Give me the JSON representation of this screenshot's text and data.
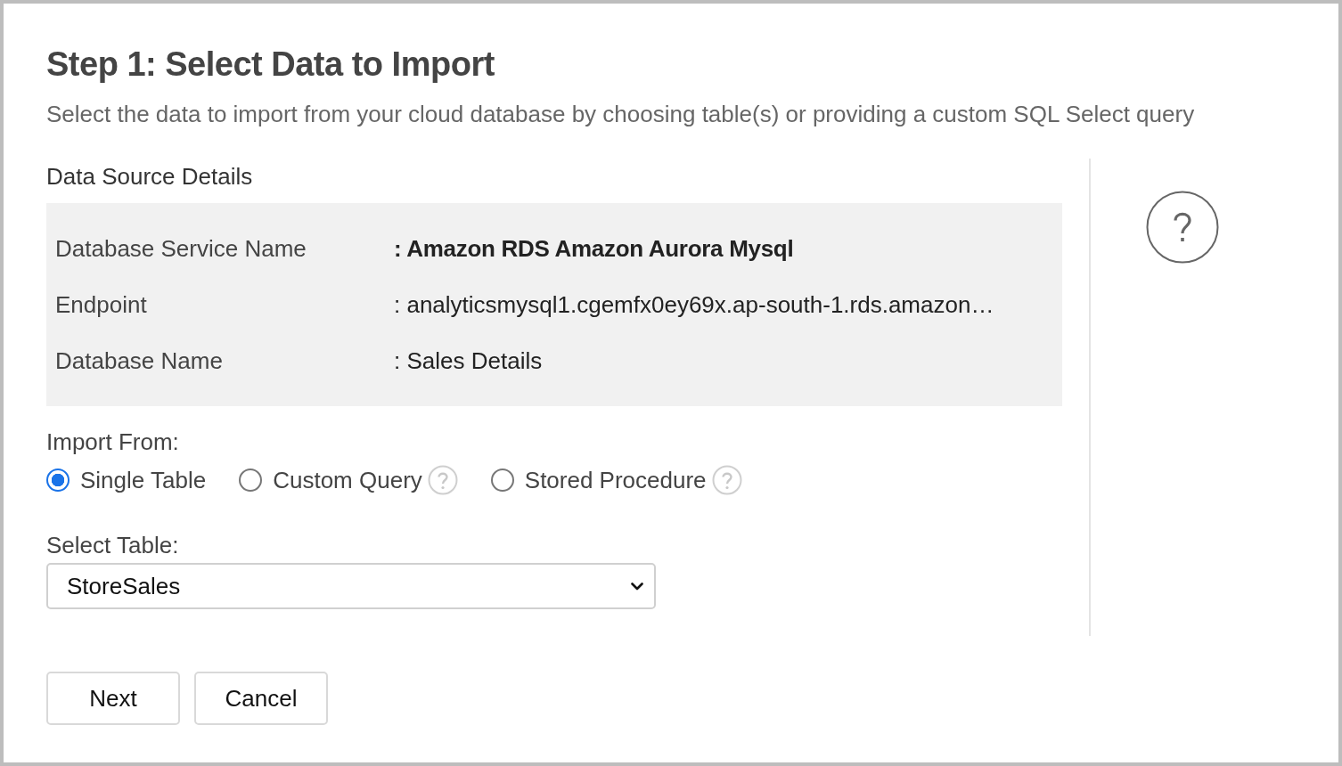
{
  "title": "Step 1: Select Data to Import",
  "subtitle": "Select the data to import from your cloud database by choosing table(s) or providing a custom SQL Select query",
  "data_source": {
    "heading": "Data Source Details",
    "rows": [
      {
        "label": "Database Service Name",
        "value": ": Amazon RDS Amazon Aurora Mysql",
        "strong": true
      },
      {
        "label": "Endpoint",
        "value": ": analyticsmysql1.cgemfx0ey69x.ap-south-1.rds.amazon…",
        "strong": false
      },
      {
        "label": "Database Name",
        "value": ": Sales Details",
        "strong": false
      }
    ]
  },
  "import_from": {
    "label": "Import From:",
    "options": [
      {
        "label": "Single Table",
        "selected": true,
        "help": false
      },
      {
        "label": "Custom Query",
        "selected": false,
        "help": true
      },
      {
        "label": "Stored Procedure",
        "selected": false,
        "help": true
      }
    ]
  },
  "select_table": {
    "label": "Select Table:",
    "value": "StoreSales"
  },
  "buttons": [
    "Next",
    "Cancel"
  ]
}
